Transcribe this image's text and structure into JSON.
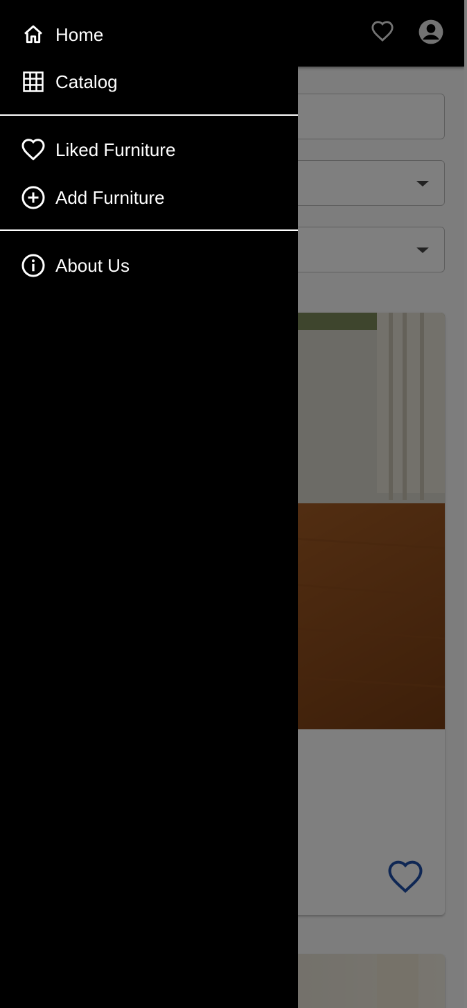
{
  "drawer": {
    "sections": [
      {
        "items": [
          {
            "label": "Home",
            "icon": "home-icon"
          },
          {
            "label": "Catalog",
            "icon": "grid-icon"
          }
        ]
      },
      {
        "items": [
          {
            "label": "Liked Furniture",
            "icon": "heart-outline-icon"
          },
          {
            "label": "Add Furniture",
            "icon": "plus-circle-icon"
          }
        ]
      },
      {
        "items": [
          {
            "label": "About Us",
            "icon": "info-circle-icon"
          }
        ]
      }
    ]
  },
  "appbar": {
    "icons": [
      "heart-outline-icon",
      "account-circle-icon"
    ]
  },
  "colors": {
    "appbar": "#000000",
    "drawer": "#000000",
    "scrim": "rgba(0,0,0,0.5)",
    "favorite_accent": "#1e4ea8"
  }
}
